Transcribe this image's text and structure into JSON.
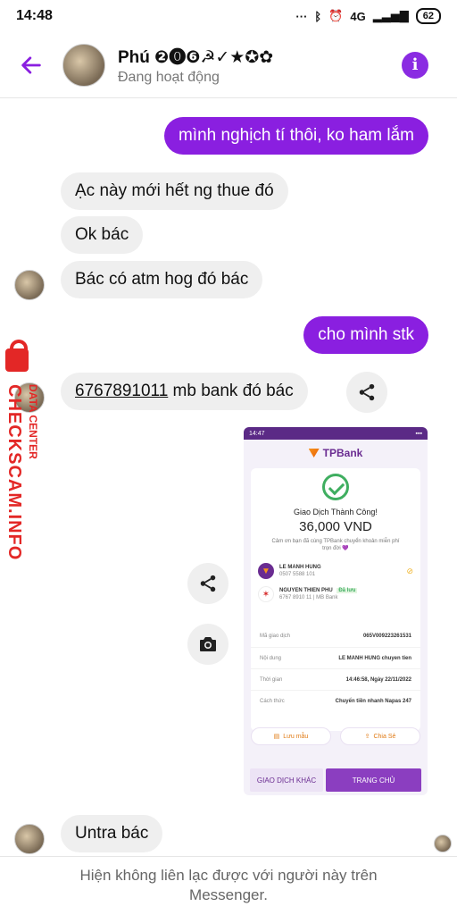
{
  "status_bar": {
    "time": "14:48",
    "network": "4G",
    "battery": "62"
  },
  "header": {
    "contact_name": "Phú ❷⓿❻☭✓★✪✿",
    "contact_status": "Đang hoạt động",
    "back_icon": "arrow-left-icon",
    "info_icon": "info-icon"
  },
  "messages": [
    {
      "id": "m1",
      "direction": "out",
      "text": "mình nghịch tí thôi, ko ham lắm"
    },
    {
      "id": "m2",
      "direction": "in",
      "text": "Ạc này mới hết ng thue đó"
    },
    {
      "id": "m3",
      "direction": "in",
      "text": "Ok bác"
    },
    {
      "id": "m4",
      "direction": "in",
      "text": "Bác có atm hog đó bác"
    },
    {
      "id": "m5",
      "direction": "out",
      "text": "cho mình stk"
    },
    {
      "id": "m6",
      "direction": "in",
      "account_number": "6767891011",
      "text_rest": " mb bank đó bác"
    },
    {
      "id": "m8",
      "direction": "in",
      "text": "Untra bác"
    }
  ],
  "receipt": {
    "status_time": "14:47",
    "brand": "TPBank",
    "success_title": "Giao Dịch Thành Công!",
    "amount": "36,000 VND",
    "thanks": "Cảm ơn bạn đã cùng TPBank chuyển khoản miễn phí trọn đời 💜",
    "sender_name": "LE MANH HUNG",
    "sender_account": "0507 5588 101",
    "receiver_name": "NGUYEN THIEN PHU",
    "receiver_tag": "Đã lưu",
    "receiver_account": "6767 8910 11  |  MB Bank",
    "rows": [
      {
        "label": "Mã giao dịch",
        "value": "065V009223261531"
      },
      {
        "label": "Nội dung",
        "value": "LE MANH HUNG chuyen tien"
      },
      {
        "label": "Thời gian",
        "value": "14:46:58, Ngày 22/11/2022"
      },
      {
        "label": "Cách thức",
        "value": "Chuyển tiền nhanh Napas 247"
      }
    ],
    "save_label": "Lưu mẫu",
    "share_label": "Chia Sẻ",
    "other_tx_label": "GIAO DỊCH KHÁC",
    "home_label": "TRANG CHỦ"
  },
  "watermark": {
    "text": "CHECKSCAM.INFO",
    "subtext": "DATA CENTER"
  },
  "footer": {
    "notice_line1": "Hiện không liên lạc được với người này trên",
    "notice_line2": "Messenger."
  },
  "colors": {
    "accent": "#8a1fe0",
    "incoming_bubble": "#efefef",
    "watermark": "#e32726"
  }
}
